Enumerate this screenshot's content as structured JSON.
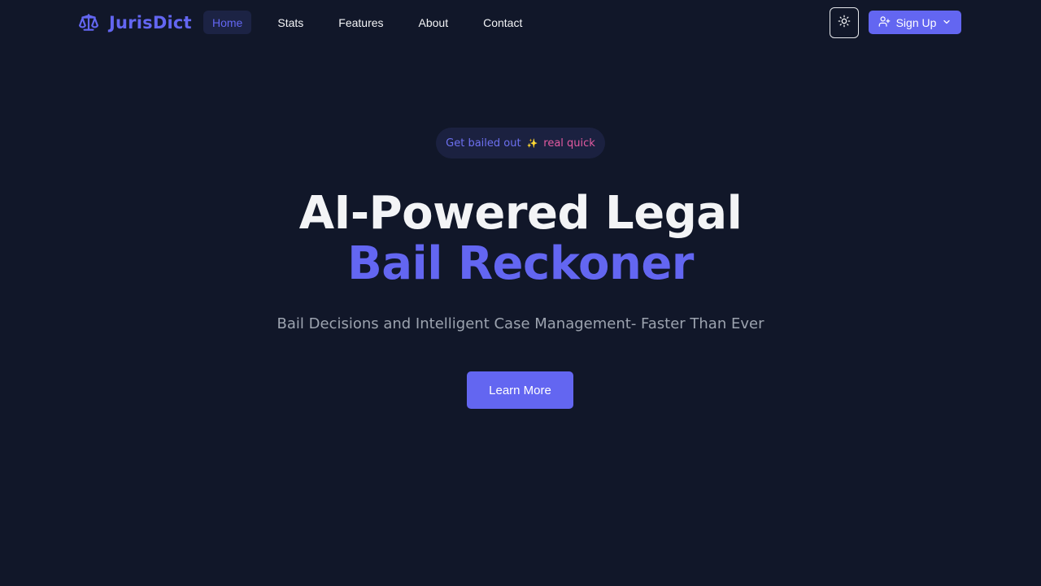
{
  "brand": {
    "name": "JurisDict",
    "icon": "scale-icon"
  },
  "nav": {
    "items": [
      {
        "label": "Home",
        "active": true
      },
      {
        "label": "Stats",
        "active": false
      },
      {
        "label": "Features",
        "active": false
      },
      {
        "label": "About",
        "active": false
      },
      {
        "label": "Contact",
        "active": false
      }
    ]
  },
  "header": {
    "theme_toggle_icon": "sun-icon",
    "signup": {
      "label": "Sign Up",
      "icon": "user-plus-icon",
      "chevron": "chevron-down-icon"
    }
  },
  "hero": {
    "badge": {
      "text_a": "Get bailed out",
      "sparkle": "✨",
      "text_b": "real quick"
    },
    "headline_line1": "AI-Powered Legal",
    "headline_line2": "Bail Reckoner",
    "subtitle": "Bail Decisions and Intelligent Case Management- Faster Than Ever",
    "cta_label": "Learn More"
  },
  "colors": {
    "background": "#111729",
    "accent": "#6366f1",
    "pink": "#e25aa0"
  }
}
